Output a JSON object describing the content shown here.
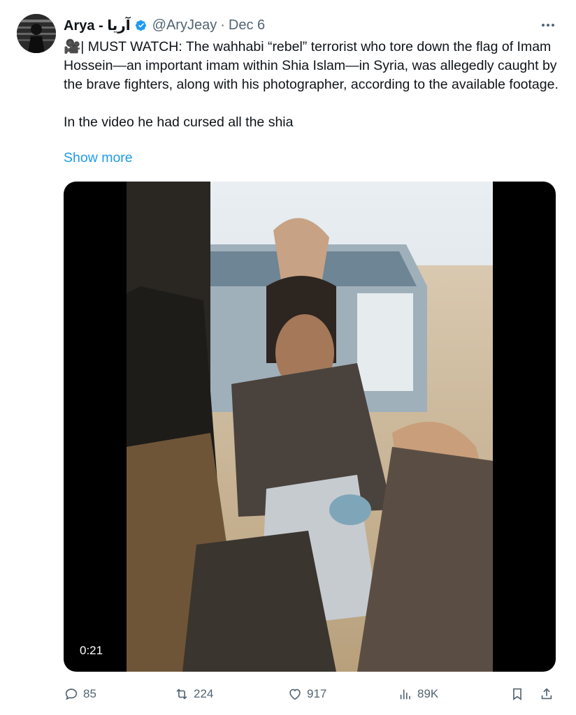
{
  "tweet": {
    "author": {
      "display_name": "Arya - آریا",
      "handle": "@AryJeay",
      "separator": "·",
      "date": "Dec 6",
      "verified_icon": "verified-badge-icon"
    },
    "body": {
      "paragraph_1": "🎥| MUST WATCH: The wahhabi “rebel” terrorist who tore down the flag of Imam Hossein—an important imam within Shia Islam—in Syria, was allegedly caught by the brave fighters, along with his photographer, according to the available footage.",
      "paragraph_2": "In the video he had cursed all the shia"
    },
    "show_more_label": "Show more",
    "media": {
      "type": "video",
      "duration": "0:21"
    },
    "actions": {
      "replies": "85",
      "reposts": "224",
      "likes": "917",
      "views": "89K"
    },
    "colors": {
      "accent": "#1d9bf0",
      "secondary_text": "#536471",
      "primary_text": "#0f1419"
    }
  }
}
